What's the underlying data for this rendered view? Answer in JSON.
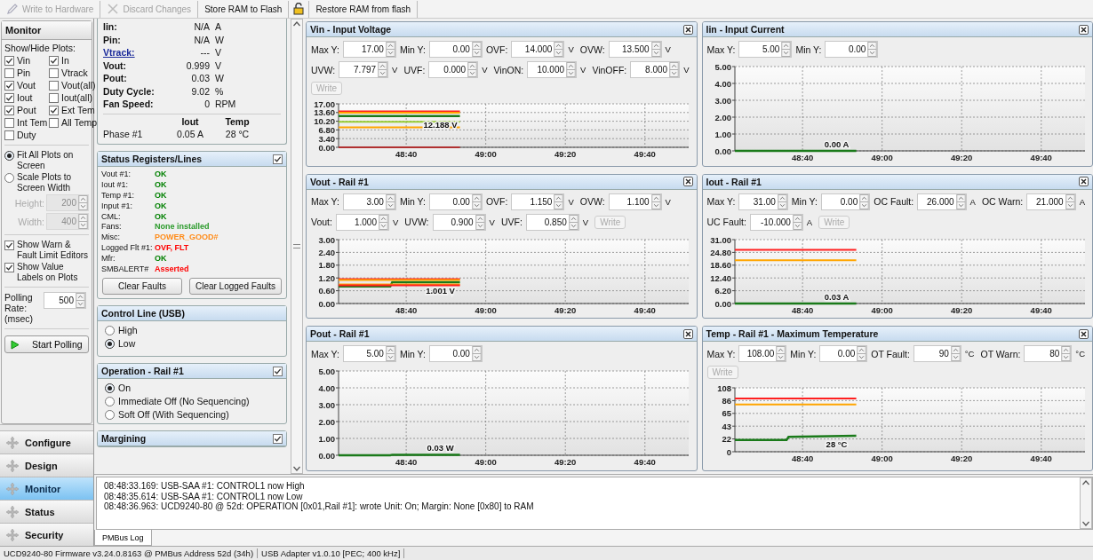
{
  "toolbar": [
    {
      "label": "Write to Hardware",
      "disabled": true
    },
    {
      "label": "Discard Changes",
      "disabled": true
    },
    {
      "label": "Store RAM to Flash",
      "disabled": false
    },
    {
      "label": "Restore RAM from flash",
      "disabled": false
    }
  ],
  "monitor": {
    "title": "Monitor",
    "plots_label": "Show/Hide Plots:",
    "plots": [
      {
        "label": "Vin",
        "checked": true
      },
      {
        "label": "In",
        "checked": true
      },
      {
        "label": "Pin",
        "checked": false
      },
      {
        "label": "Vtrack",
        "checked": false
      },
      {
        "label": "Vout",
        "checked": true
      },
      {
        "label": "Vout(all)",
        "checked": false
      },
      {
        "label": "Iout",
        "checked": true
      },
      {
        "label": "Iout(all)",
        "checked": false
      },
      {
        "label": "Pout",
        "checked": true
      },
      {
        "label": "Ext Tem",
        "checked": true
      },
      {
        "label": "Int Tem",
        "checked": false
      },
      {
        "label": "All Temp",
        "checked": false
      },
      {
        "label": "Duty",
        "checked": false
      }
    ],
    "scale_modes": [
      {
        "label": "Fit All Plots on Screen",
        "selected": true
      },
      {
        "label": "Scale Plots to Screen Width",
        "selected": false
      }
    ],
    "size_fields": [
      {
        "label": "Height:",
        "value": "200",
        "disabled": true
      },
      {
        "label": "Width:",
        "value": "400",
        "disabled": true
      }
    ],
    "options": [
      {
        "label": "Show Warn & Fault Limit Editors",
        "checked": true
      },
      {
        "label": "Show Value Labels on Plots",
        "checked": true
      }
    ],
    "polling": {
      "label": "Polling Rate:",
      "unit": "(msec)",
      "value": "500"
    },
    "start_button": "Start Polling"
  },
  "nav": [
    {
      "label": "Configure",
      "selected": false
    },
    {
      "label": "Design",
      "selected": false
    },
    {
      "label": "Monitor",
      "selected": true
    },
    {
      "label": "Status",
      "selected": false
    },
    {
      "label": "Security",
      "selected": false
    }
  ],
  "readings": {
    "rows": [
      {
        "label": "Iin:",
        "value": "N/A",
        "unit": "A",
        "link": false
      },
      {
        "label": "Pin:",
        "value": "N/A",
        "unit": "W",
        "link": false
      },
      {
        "label": "Vtrack:",
        "value": "---",
        "unit": "V",
        "link": true
      },
      {
        "label": "Vout:",
        "value": "0.999",
        "unit": "V",
        "link": false
      },
      {
        "label": "Pout:",
        "value": "0.03",
        "unit": "W",
        "link": false
      },
      {
        "label": "Duty Cycle:",
        "value": "9.02",
        "unit": "%",
        "link": false
      },
      {
        "label": "Fan Speed:",
        "value": "0",
        "unit": "RPM",
        "link": false
      }
    ],
    "phase_headers": [
      "Iout",
      "Temp"
    ],
    "phases": [
      {
        "label": "Phase #1",
        "iout": "0.05 A",
        "temp": "28 °C"
      }
    ]
  },
  "status_panel": {
    "title": "Status Registers/Lines",
    "checked": true,
    "rows": [
      {
        "label": "Vout #1:",
        "value": "OK",
        "color": "#008000"
      },
      {
        "label": "Iout #1:",
        "value": "OK",
        "color": "#008000"
      },
      {
        "label": "Temp #1:",
        "value": "OK",
        "color": "#008000"
      },
      {
        "label": "Input #1:",
        "value": "OK",
        "color": "#008000"
      },
      {
        "label": "CML:",
        "value": "OK",
        "color": "#008000"
      },
      {
        "label": "Fans:",
        "value": "None installed",
        "color": "#2a9a2a"
      },
      {
        "label": "Misc:",
        "value": "POWER_GOOD#",
        "color": "#ff8c1a"
      },
      {
        "label": "Logged Flt #1:",
        "value": "OVF, FLT",
        "color": "#ff0000"
      },
      {
        "label": "Mfr:",
        "value": "OK",
        "color": "#008000"
      },
      {
        "label": "SMBALERT#",
        "value": "Asserted",
        "color": "#ff0000"
      }
    ],
    "buttons": [
      "Clear Faults",
      "Clear Logged Faults"
    ]
  },
  "control_line": {
    "title": "Control Line (USB)",
    "options": [
      {
        "label": "High",
        "selected": false
      },
      {
        "label": "Low",
        "selected": true
      }
    ]
  },
  "operation": {
    "title": "Operation - Rail #1",
    "checked": true,
    "options": [
      {
        "label": "On",
        "selected": true
      },
      {
        "label": "Immediate Off (No Sequencing)",
        "selected": false
      },
      {
        "label": "Soft Off (With Sequencing)",
        "selected": false
      }
    ]
  },
  "margining": {
    "title": "Margining",
    "checked": true
  },
  "plots": [
    {
      "title": "Vin - Input Voltage",
      "rows": [
        [
          {
            "kind": "spin",
            "label": "Max Y:",
            "value": "17.00"
          },
          {
            "kind": "spin",
            "label": "Min Y:",
            "value": "0.00"
          },
          {
            "kind": "spin",
            "label": "OVF:",
            "value": "14.000",
            "unit": "V"
          },
          {
            "kind": "spin",
            "label": "OVW:",
            "value": "13.500",
            "unit": "V"
          }
        ],
        [
          {
            "kind": "spin",
            "label": "UVW:",
            "value": "7.797",
            "unit": "V"
          },
          {
            "kind": "spin",
            "label": "UVF:",
            "value": "0.000",
            "unit": "V"
          },
          {
            "kind": "spin",
            "label": "VinON:",
            "value": "10.000",
            "unit": "V"
          },
          {
            "kind": "spin",
            "label": "VinOFF:",
            "value": "8.000",
            "unit": "V"
          }
        ],
        [
          {
            "kind": "button",
            "label": "Write",
            "disabled": true
          }
        ]
      ],
      "chart_data": {
        "type": "line",
        "x": [
          2903,
          2916,
          2916.5,
          2933.5
        ],
        "xlim": [
          2903,
          2991
        ],
        "ylim": [
          0,
          17
        ],
        "xticks": [
          {
            "value": 2920,
            "label": "48:40"
          },
          {
            "value": 2940,
            "label": "49:00"
          },
          {
            "value": 2960,
            "label": "49:20"
          },
          {
            "value": 2980,
            "label": "49:40"
          }
        ],
        "yticks": [
          {
            "value": 0,
            "label": "0.00"
          },
          {
            "value": 3.4,
            "label": "3.40"
          },
          {
            "value": 6.8,
            "label": "6.80"
          },
          {
            "value": 10.2,
            "label": "10.20"
          },
          {
            "value": 13.6,
            "label": "13.60"
          },
          {
            "value": 17,
            "label": "17.00"
          }
        ],
        "series": [
          {
            "color": "#1a7a1a",
            "values": [
              12.2,
              12.2,
              12.2,
              12.2
            ]
          },
          {
            "color": "#ff2020",
            "values": [
              14,
              14,
              14,
              14
            ]
          },
          {
            "color": "#ffa500",
            "values": [
              13.5,
              13.5,
              13.5,
              13.5
            ]
          },
          {
            "color": "#99cc33",
            "values": [
              10,
              10,
              10,
              10
            ]
          },
          {
            "color": "#ffa500",
            "values": [
              7.8,
              7.8,
              7.8,
              7.8
            ]
          },
          {
            "color": "#b03030",
            "values": [
              0,
              0,
              0,
              0
            ]
          }
        ],
        "annotations": [
          "12.188 V"
        ],
        "grid": true
      }
    },
    {
      "title": "Iin - Input Current",
      "rows": [
        [
          {
            "kind": "spin",
            "label": "Max Y:",
            "value": "5.00"
          },
          {
            "kind": "spin",
            "label": "Min Y:",
            "value": "0.00"
          }
        ]
      ],
      "chart_data": {
        "type": "line",
        "x": [
          2903,
          2916,
          2916.5,
          2933.5
        ],
        "xlim": [
          2903,
          2991
        ],
        "ylim": [
          0,
          5
        ],
        "xticks": [
          {
            "value": 2920,
            "label": "48:40"
          },
          {
            "value": 2940,
            "label": "49:00"
          },
          {
            "value": 2960,
            "label": "49:20"
          },
          {
            "value": 2980,
            "label": "49:40"
          }
        ],
        "yticks": [
          {
            "value": 0,
            "label": "0.00"
          },
          {
            "value": 1,
            "label": "1.00"
          },
          {
            "value": 2,
            "label": "2.00"
          },
          {
            "value": 3,
            "label": "3.00"
          },
          {
            "value": 4,
            "label": "4.00"
          },
          {
            "value": 5,
            "label": "5.00"
          }
        ],
        "series": [
          {
            "color": "#1a7a1a",
            "values": [
              0,
              0,
              0,
              0
            ]
          }
        ],
        "annotations": [
          "0.00 A"
        ],
        "grid": true
      }
    },
    {
      "title": "Vout - Rail #1",
      "rows": [
        [
          {
            "kind": "spin",
            "label": "Max Y:",
            "value": "3.00"
          },
          {
            "kind": "spin",
            "label": "Min Y:",
            "value": "0.00"
          },
          {
            "kind": "spin",
            "label": "OVF:",
            "value": "1.150",
            "unit": "V"
          },
          {
            "kind": "spin",
            "label": "OVW:",
            "value": "1.100",
            "unit": "V"
          }
        ],
        [
          {
            "kind": "spin",
            "label": "Vout:",
            "value": "1.000",
            "unit": "V"
          },
          {
            "kind": "spin",
            "label": "UVW:",
            "value": "0.900",
            "unit": "V"
          },
          {
            "kind": "spin",
            "label": "UVF:",
            "value": "0.850",
            "unit": "V"
          },
          {
            "kind": "button",
            "label": "Write",
            "disabled": true
          }
        ]
      ],
      "chart_data": {
        "type": "line",
        "x": [
          2903,
          2916,
          2916.5,
          2933.5
        ],
        "xlim": [
          2903,
          2991
        ],
        "ylim": [
          0,
          3
        ],
        "xticks": [
          {
            "value": 2920,
            "label": "48:40"
          },
          {
            "value": 2940,
            "label": "49:00"
          },
          {
            "value": 2960,
            "label": "49:20"
          },
          {
            "value": 2980,
            "label": "49:40"
          }
        ],
        "yticks": [
          {
            "value": 0,
            "label": "0.00"
          },
          {
            "value": 0.6,
            "label": "0.60"
          },
          {
            "value": 1.2,
            "label": "1.20"
          },
          {
            "value": 1.8,
            "label": "1.80"
          },
          {
            "value": 2.4,
            "label": "2.40"
          },
          {
            "value": 3,
            "label": "3.00"
          }
        ],
        "series": [
          {
            "color": "#1a7a1a",
            "values": [
              0.8,
              0.8,
              1,
              1
            ]
          },
          {
            "color": "#ff2020",
            "values": [
              1.15,
              1.15,
              1.15,
              1.15
            ]
          },
          {
            "color": "#ffa500",
            "values": [
              1.1,
              1.1,
              1.1,
              1.1
            ]
          },
          {
            "color": "#ffa500",
            "values": [
              0.9,
              0.9,
              0.9,
              0.9
            ]
          },
          {
            "color": "#ff2020",
            "values": [
              0.85,
              0.85,
              0.85,
              0.85
            ]
          }
        ],
        "annotations": [
          "1.001 V"
        ],
        "grid": true
      }
    },
    {
      "title": "Iout - Rail #1",
      "rows": [
        [
          {
            "kind": "spin",
            "label": "Max Y:",
            "value": "31.00"
          },
          {
            "kind": "spin",
            "label": "Min Y:",
            "value": "0.00"
          },
          {
            "kind": "spin",
            "label": "OC Fault:",
            "value": "26.000",
            "unit": "A"
          },
          {
            "kind": "spin",
            "label": "OC Warn:",
            "value": "21.000",
            "unit": "A"
          }
        ],
        [
          {
            "kind": "spin",
            "label": "UC Fault:",
            "value": "-10.000",
            "unit": "A"
          },
          {
            "kind": "button",
            "label": "Write",
            "disabled": true
          }
        ]
      ],
      "chart_data": {
        "type": "line",
        "x": [
          2903,
          2916,
          2916.5,
          2933.5
        ],
        "xlim": [
          2903,
          2991
        ],
        "ylim": [
          0,
          31
        ],
        "xticks": [
          {
            "value": 2920,
            "label": "48:40"
          },
          {
            "value": 2940,
            "label": "49:00"
          },
          {
            "value": 2960,
            "label": "49:20"
          },
          {
            "value": 2980,
            "label": "49:40"
          }
        ],
        "yticks": [
          {
            "value": 0,
            "label": "0.00"
          },
          {
            "value": 6.2,
            "label": "6.20"
          },
          {
            "value": 12.4,
            "label": "12.40"
          },
          {
            "value": 18.6,
            "label": "18.60"
          },
          {
            "value": 24.8,
            "label": "24.80"
          },
          {
            "value": 31,
            "label": "31.00"
          }
        ],
        "series": [
          {
            "color": "#1a7a1a",
            "values": [
              0,
              0,
              0,
              0
            ]
          },
          {
            "color": "#ff2020",
            "values": [
              26,
              26,
              26,
              26
            ]
          },
          {
            "color": "#ffa500",
            "values": [
              21,
              21,
              21,
              21
            ]
          }
        ],
        "annotations": [
          "0.03 A"
        ],
        "grid": true
      }
    },
    {
      "title": "Pout - Rail #1",
      "rows": [
        [
          {
            "kind": "spin",
            "label": "Max Y:",
            "value": "5.00"
          },
          {
            "kind": "spin",
            "label": "Min Y:",
            "value": "0.00"
          }
        ]
      ],
      "chart_data": {
        "type": "line",
        "x": [
          2903,
          2916,
          2916.5,
          2933.5
        ],
        "xlim": [
          2903,
          2991
        ],
        "ylim": [
          0,
          5
        ],
        "xticks": [
          {
            "value": 2920,
            "label": "48:40"
          },
          {
            "value": 2940,
            "label": "49:00"
          },
          {
            "value": 2960,
            "label": "49:20"
          },
          {
            "value": 2980,
            "label": "49:40"
          }
        ],
        "yticks": [
          {
            "value": 0,
            "label": "0.00"
          },
          {
            "value": 1,
            "label": "1.00"
          },
          {
            "value": 2,
            "label": "2.00"
          },
          {
            "value": 3,
            "label": "3.00"
          },
          {
            "value": 4,
            "label": "4.00"
          },
          {
            "value": 5,
            "label": "5.00"
          }
        ],
        "series": [
          {
            "color": "#1a7a1a",
            "values": [
              0,
              0,
              0.03,
              0.03
            ]
          }
        ],
        "annotations": [
          "0.03 W"
        ],
        "grid": true
      }
    },
    {
      "title": "Temp - Rail #1 - Maximum Temperature",
      "rows": [
        [
          {
            "kind": "spin",
            "label": "Max Y:",
            "value": "108.00"
          },
          {
            "kind": "spin",
            "label": "Min Y:",
            "value": "0.00"
          },
          {
            "kind": "spin",
            "label": "OT Fault:",
            "value": "90",
            "unit": "°C"
          },
          {
            "kind": "spin",
            "label": "OT Warn:",
            "value": "80",
            "unit": "°C"
          }
        ],
        [
          {
            "kind": "button",
            "label": "Write",
            "disabled": true
          }
        ]
      ],
      "chart_data": {
        "type": "line",
        "x": [
          2903,
          2916,
          2916.5,
          2933.5
        ],
        "xlim": [
          2903,
          2991
        ],
        "ylim": [
          0,
          108
        ],
        "xticks": [
          {
            "value": 2920,
            "label": "48:40"
          },
          {
            "value": 2940,
            "label": "49:00"
          },
          {
            "value": 2960,
            "label": "49:20"
          },
          {
            "value": 2980,
            "label": "49:40"
          }
        ],
        "yticks": [
          {
            "value": 0,
            "label": "0"
          },
          {
            "value": 21.6,
            "label": "22"
          },
          {
            "value": 43.2,
            "label": "43"
          },
          {
            "value": 64.8,
            "label": "65"
          },
          {
            "value": 86.4,
            "label": "86"
          },
          {
            "value": 108,
            "label": "108"
          }
        ],
        "series": [
          {
            "color": "#1a7a1a",
            "values": [
              20,
              20,
              25,
              27
            ]
          },
          {
            "color": "#ff2020",
            "values": [
              90,
              90,
              90,
              90
            ]
          },
          {
            "color": "#ffa500",
            "values": [
              80,
              80,
              80,
              80
            ]
          }
        ],
        "annotations": [
          "28 °C"
        ],
        "grid": true
      }
    }
  ],
  "log": {
    "lines": [
      "08:48:33.169: USB-SAA #1: CONTROL1 now High",
      "08:48:35.614: USB-SAA #1: CONTROL1 now Low",
      "08:48:36.963: UCD9240-80 @ 52d: OPERATION [0x01,Rail #1]: wrote Unit: On; Margin: None [0x80] to RAM"
    ],
    "tab": "PMBus Log"
  },
  "status_bar": [
    "UCD9240-80 Firmware v3.24.0.8163 @ PMBus Address 52d (34h)",
    "USB Adapter v1.0.10 [PEC; 400 kHz]"
  ]
}
